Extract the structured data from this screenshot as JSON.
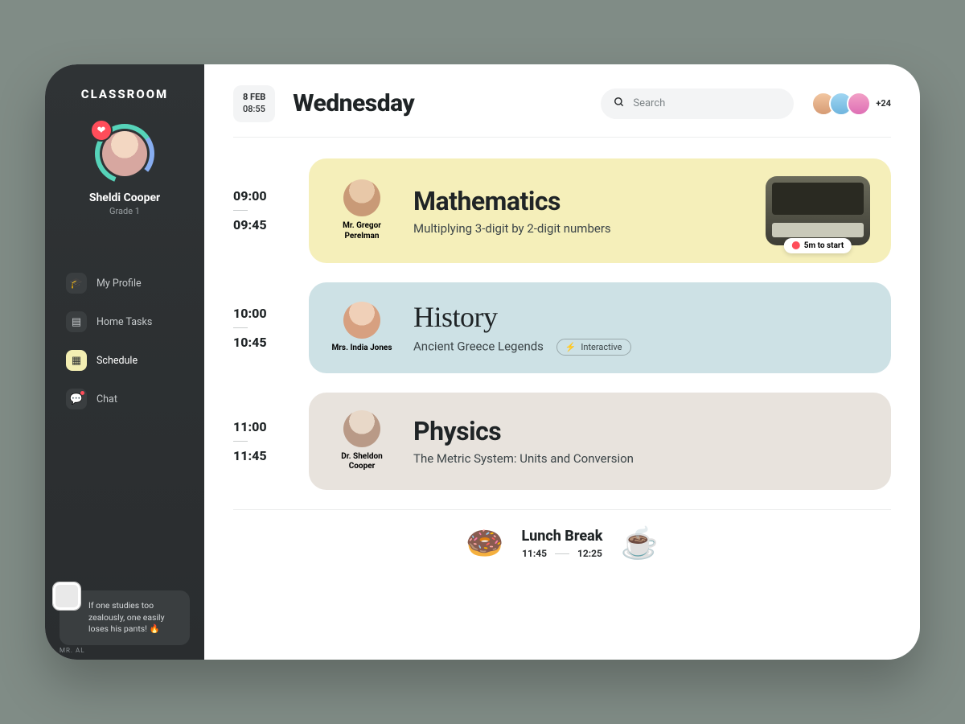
{
  "brand": "CLASSROOM",
  "user": {
    "name": "Sheldi Cooper",
    "grade": "Grade 1"
  },
  "nav": {
    "profile": "My Profile",
    "hometasks": "Home Tasks",
    "schedule": "Schedule",
    "chat": "Chat"
  },
  "quote": {
    "text": "If one studies too zealously, one easily loses his pants! 🔥",
    "author": "MR. AL"
  },
  "header": {
    "date": "8 FEB",
    "time": "08:55",
    "day": "Wednesday",
    "search_placeholder": "Search",
    "more_count": "+24"
  },
  "lessons": [
    {
      "start": "09:00",
      "end": "09:45",
      "teacher": "Mr. Gregor Perelman",
      "title": "Mathematics",
      "desc": "Multiplying 3-digit by 2-digit numbers",
      "badge": "5m to start"
    },
    {
      "start": "10:00",
      "end": "10:45",
      "teacher": "Mrs. India Jones",
      "title": "History",
      "desc": "Ancient Greece Legends",
      "tag": "Interactive"
    },
    {
      "start": "11:00",
      "end": "11:45",
      "teacher": "Dr. Sheldon Cooper",
      "title": "Physics",
      "desc": "The Metric System: Units and Conversion"
    }
  ],
  "break": {
    "title": "Lunch Break",
    "start": "11:45",
    "end": "12:25"
  }
}
